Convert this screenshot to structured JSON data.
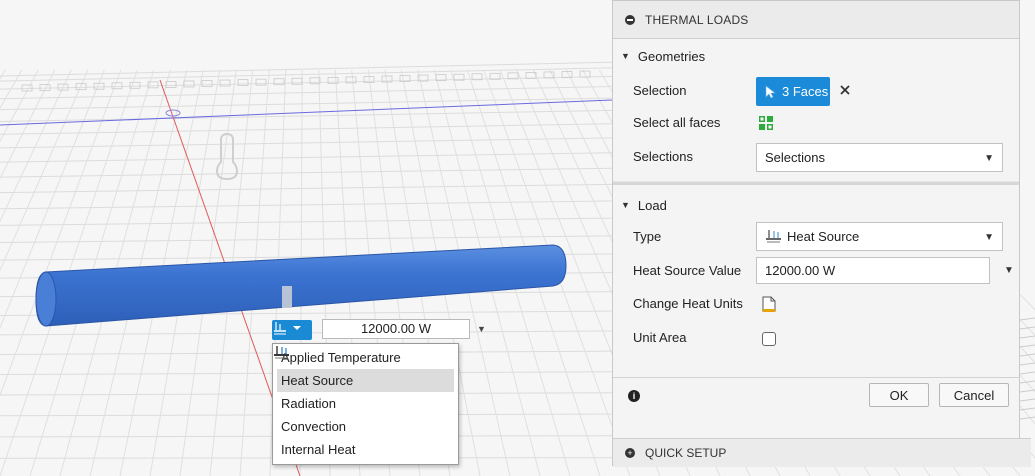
{
  "viewport": {
    "heat_value": "12000.00 W",
    "type_menu": {
      "items": [
        {
          "label": "Applied Temperature",
          "icon": "applied-temperature-icon"
        },
        {
          "label": "Heat Source",
          "icon": "heat-source-icon",
          "selected": true
        },
        {
          "label": "Radiation",
          "icon": "radiation-icon"
        },
        {
          "label": "Convection",
          "icon": "convection-icon"
        },
        {
          "label": "Internal Heat",
          "icon": "internal-heat-icon"
        }
      ]
    }
  },
  "panel": {
    "title": "THERMAL LOADS",
    "geometries": {
      "heading": "Geometries",
      "selection_label": "Selection",
      "faces_button": "3 Faces",
      "select_all_label": "Select all faces",
      "selections_label": "Selections",
      "selections_value": "Selections"
    },
    "load": {
      "heading": "Load",
      "type_label": "Type",
      "type_value": "Heat Source",
      "heat_value_label": "Heat Source Value",
      "heat_value": "12000.00 W",
      "change_units_label": "Change Heat Units",
      "unit_area_label": "Unit Area",
      "unit_area_checked": false
    },
    "footer": {
      "ok": "OK",
      "cancel": "Cancel"
    },
    "quick_setup": "QUICK SETUP"
  },
  "colors": {
    "accent": "#1b8ad8",
    "cylinder": "#3b74d0",
    "axis_red": "#e05a5a",
    "axis_blue": "#6a6ae0"
  }
}
